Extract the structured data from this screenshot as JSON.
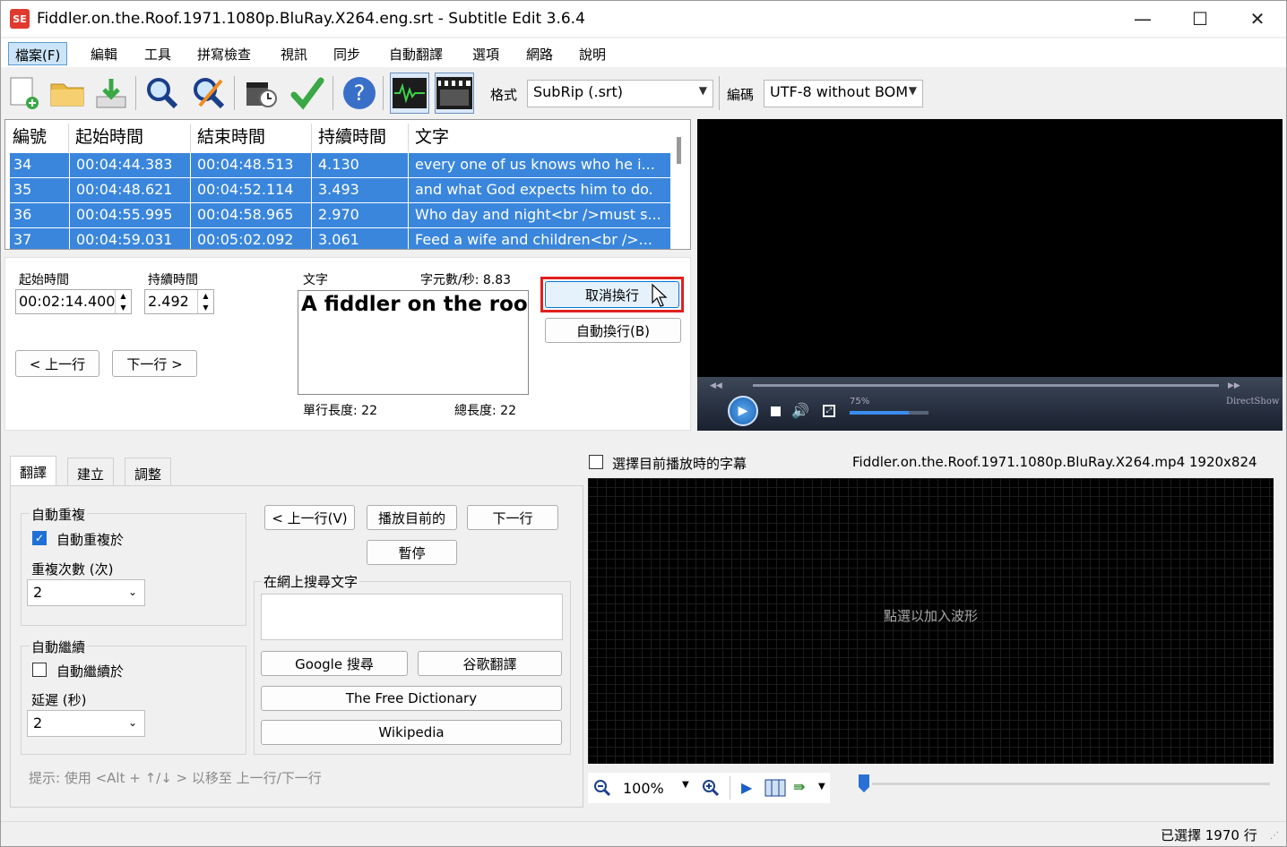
{
  "window": {
    "title": "Fiddler.on.the.Roof.1971.1080p.BluRay.X264.eng.srt - Subtitle Edit 3.6.4",
    "app_icon_text": "SE",
    "minimize": "—",
    "maximize": "☐",
    "close": "✕"
  },
  "menu": [
    "檔案(F)",
    "編輯",
    "工具",
    "拼寫檢查",
    "視訊",
    "同步",
    "自動翻譯",
    "選項",
    "網路",
    "說明"
  ],
  "toolbar": {
    "format_label": "格式",
    "format_value": "SubRip (.srt)",
    "encoding_label": "編碼",
    "encoding_value": "UTF-8 without BOM"
  },
  "grid": {
    "columns": [
      "編號",
      "起始時間",
      "結束時間",
      "持續時間",
      "文字"
    ],
    "rows": [
      {
        "num": "34",
        "start": "00:04:44.383",
        "end": "00:04:48.513",
        "dur": "4.130",
        "text": "every one of us knows who he i..."
      },
      {
        "num": "35",
        "start": "00:04:48.621",
        "end": "00:04:52.114",
        "dur": "3.493",
        "text": "and what God expects him to do."
      },
      {
        "num": "36",
        "start": "00:04:55.995",
        "end": "00:04:58.965",
        "dur": "2.970",
        "text": "Who day and night<br />must s..."
      },
      {
        "num": "37",
        "start": "00:04:59.031",
        "end": "00:05:02.092",
        "dur": "3.061",
        "text": "Feed a wife and children<br />..."
      }
    ]
  },
  "editor": {
    "start_label": "起始時間",
    "start_value": "00:02:14.400",
    "duration_label": "持續時間",
    "duration_value": "2.492",
    "text_label": "文字",
    "cps_label": "字元數/秒: 8.83",
    "text_value": "A fiddler on the roof.",
    "line_length": "單行長度: 22",
    "total_length": "總長度: 22",
    "prev_button": "< 上一行",
    "next_button": "下一行 >",
    "unbreak_button": "取消換行",
    "autobreak_button": "自動換行(B)"
  },
  "video": {
    "volume_text": "75%",
    "brand_text": "DirectShow",
    "volume_level": 0.75
  },
  "lower": {
    "tabs": [
      "翻譯",
      "建立",
      "調整"
    ],
    "auto_repeat_group": "自動重複",
    "auto_repeat_check": "自動重複於",
    "repeat_count_label": "重複次數 (次)",
    "repeat_count_value": "2",
    "auto_continue_group": "自動繼續",
    "auto_continue_check": "自動繼續於",
    "delay_label": "延遲 (秒)",
    "delay_value": "2",
    "prev_line_btn": "< 上一行(V)",
    "play_current_btn": "播放目前的",
    "next_line_btn": "下一行",
    "pause_btn": "暫停",
    "search_web_label": "在網上搜尋文字",
    "google_search_btn": "Google 搜尋",
    "google_translate_btn": "谷歌翻譯",
    "free_dictionary_btn": "The Free Dictionary",
    "wikipedia_btn": "Wikipedia",
    "hint": "提示: 使用 <Alt + ↑/↓ > 以移至 上一行/下一行"
  },
  "waveform": {
    "select_current_label": "選擇目前播放時的字幕",
    "video_info": "Fiddler.on.the.Roof.1971.1080p.BluRay.X264.mp4 1920x824",
    "placeholder": "點選以加入波形",
    "zoom": "100%"
  },
  "status": {
    "selected": "已選擇 1970 行"
  }
}
